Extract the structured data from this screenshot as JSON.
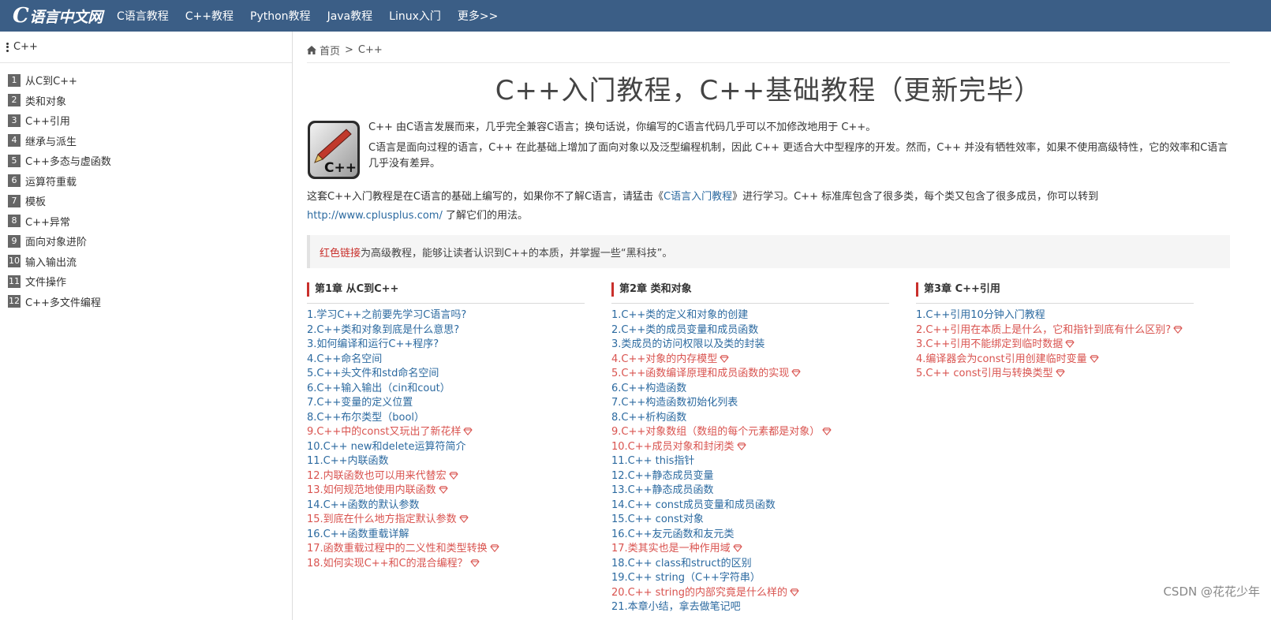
{
  "nav": {
    "logo": "C语言中文网",
    "logo_c": "C",
    "logo_rest": "语言中文网",
    "items": [
      "C语言教程",
      "C++教程",
      "Python教程",
      "Java教程",
      "Linux入门",
      "更多>>"
    ],
    "bg_color": "#3b5e86"
  },
  "sidebar": {
    "title": "C++",
    "items": [
      {
        "num": "1",
        "label": "从C到C++"
      },
      {
        "num": "2",
        "label": "类和对象"
      },
      {
        "num": "3",
        "label": "C++引用"
      },
      {
        "num": "4",
        "label": "继承与派生"
      },
      {
        "num": "5",
        "label": "C++多态与虚函数"
      },
      {
        "num": "6",
        "label": "运算符重载"
      },
      {
        "num": "7",
        "label": "模板"
      },
      {
        "num": "8",
        "label": "C++异常"
      },
      {
        "num": "9",
        "label": "面向对象进阶"
      },
      {
        "num": "10",
        "label": "输入输出流"
      },
      {
        "num": "11",
        "label": "文件操作"
      },
      {
        "num": "12",
        "label": "C++多文件编程"
      }
    ]
  },
  "breadcrumb": {
    "home": "首页",
    "sep": ">",
    "current": "C++"
  },
  "title": "C++入门教程，C++基础教程（更新完毕）",
  "intro": {
    "logo_text": "C++",
    "p1": "C++ 由C语言发展而来，几乎完全兼容C语言；换句话说，你编写的C语言代码几乎可以不加修改地用于 C++。",
    "p2": "C语言是面向过程的语言，C++ 在此基础上增加了面向对象以及泛型编程机制，因此 C++ 更适合大中型程序的开发。然而，C++ 并没有牺牲效率，如果不使用高级特性，它的效率和C语言几乎没有差异。"
  },
  "para": {
    "t1": "这套C++入门教程是在C语言的基础上编写的，如果你不了解C语言，请猛击《",
    "link1": "C语言入门教程",
    "t2": "》进行学习。C++ 标准库包含了很多类，每个类又包含了很多成员，你可以转到 ",
    "link2": "http://www.cplusplus.com/",
    "t3": " 了解它们的用法。"
  },
  "notice": {
    "red": "红色链接",
    "text": "为高级教程，能够让读者认识到C++的本质，并掌握一些“黑科技”。"
  },
  "chapters": [
    {
      "title": "第1章 从C到C++",
      "items": [
        {
          "text": "1.学习C++之前要先学习C语言吗?",
          "red": false
        },
        {
          "text": "2.C++类和对象到底是什么意思?",
          "red": false
        },
        {
          "text": "3.如何编译和运行C++程序?",
          "red": false
        },
        {
          "text": "4.C++命名空间",
          "red": false
        },
        {
          "text": "5.C++头文件和std命名空间",
          "red": false
        },
        {
          "text": "6.C++输入输出（cin和cout）",
          "red": false
        },
        {
          "text": "7.C++变量的定义位置",
          "red": false
        },
        {
          "text": "8.C++布尔类型（bool）",
          "red": false
        },
        {
          "text": "9.C++中的const又玩出了新花样",
          "red": true
        },
        {
          "text": "10.C++ new和delete运算符简介",
          "red": false
        },
        {
          "text": "11.C++内联函数",
          "red": false
        },
        {
          "text": "12.内联函数也可以用来代替宏",
          "red": true
        },
        {
          "text": "13.如何规范地使用内联函数",
          "red": true
        },
        {
          "text": "14.C++函数的默认参数",
          "red": false
        },
        {
          "text": "15.到底在什么地方指定默认参数",
          "red": true
        },
        {
          "text": "16.C++函数重载详解",
          "red": false
        },
        {
          "text": "17.函数重载过程中的二义性和类型转换",
          "red": true
        },
        {
          "text": "18.如何实现C++和C的混合编程？",
          "red": true
        }
      ]
    },
    {
      "title": "第2章 类和对象",
      "items": [
        {
          "text": "1.C++类的定义和对象的创建",
          "red": false
        },
        {
          "text": "2.C++类的成员变量和成员函数",
          "red": false
        },
        {
          "text": "3.类成员的访问权限以及类的封装",
          "red": false
        },
        {
          "text": "4.C++对象的内存模型",
          "red": true
        },
        {
          "text": "5.C++函数编译原理和成员函数的实现",
          "red": true
        },
        {
          "text": "6.C++构造函数",
          "red": false
        },
        {
          "text": "7.C++构造函数初始化列表",
          "red": false
        },
        {
          "text": "8.C++析构函数",
          "red": false
        },
        {
          "text": "9.C++对象数组（数组的每个元素都是对象）",
          "red": true
        },
        {
          "text": "10.C++成员对象和封闭类",
          "red": true
        },
        {
          "text": "11.C++ this指针",
          "red": false
        },
        {
          "text": "12.C++静态成员变量",
          "red": false
        },
        {
          "text": "13.C++静态成员函数",
          "red": false
        },
        {
          "text": "14.C++ const成员变量和成员函数",
          "red": false
        },
        {
          "text": "15.C++ const对象",
          "red": false
        },
        {
          "text": "16.C++友元函数和友元类",
          "red": false
        },
        {
          "text": "17.类其实也是一种作用域",
          "red": true
        },
        {
          "text": "18.C++ class和struct的区别",
          "red": false
        },
        {
          "text": "19.C++ string（C++字符串）",
          "red": false
        },
        {
          "text": "20.C++ string的内部究竟是什么样的",
          "red": true
        },
        {
          "text": "21.本章小结，拿去做笔记吧",
          "red": false
        }
      ]
    },
    {
      "title": "第3章 C++引用",
      "items": [
        {
          "text": "1.C++引用10分钟入门教程",
          "red": false
        },
        {
          "text": "2.C++引用在本质上是什么，它和指针到底有什么区别?",
          "red": true
        },
        {
          "text": "3.C++引用不能绑定到临时数据",
          "red": true
        },
        {
          "text": "4.编译器会为const引用创建临时变量",
          "red": true
        },
        {
          "text": "5.C++ const引用与转换类型",
          "red": true
        }
      ]
    }
  ],
  "watermark": "CSDN @花花少年",
  "colors": {
    "link_blue": "#2c6aa0",
    "advanced_red": "#d9534f",
    "chapter_bar": "#c9302c"
  }
}
